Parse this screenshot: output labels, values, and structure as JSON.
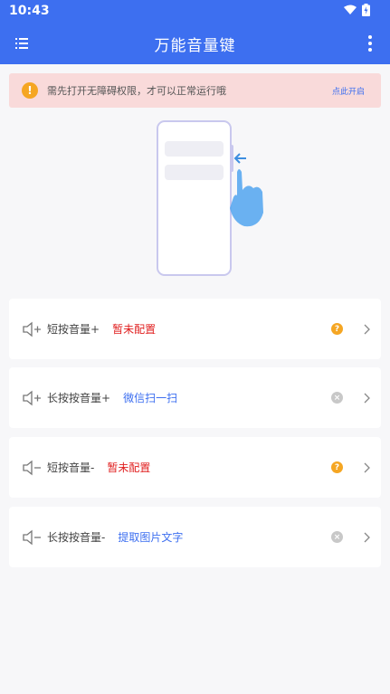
{
  "status_bar": {
    "time": "10:43"
  },
  "header": {
    "title": "万能音量键"
  },
  "banner": {
    "text": "需先打开无障碍权限，才可以正常运行哦",
    "link": "点此开启"
  },
  "cards": [
    {
      "label": "短按音量+",
      "value": "暂未配置",
      "value_color": "red",
      "status": "unconfigured",
      "icon": "volume-plus-icon"
    },
    {
      "label": "长按按音量+",
      "value": "微信扫一扫",
      "value_color": "blue",
      "status": "configured",
      "icon": "volume-plus-icon"
    },
    {
      "label": "短按音量-",
      "value": "暂未配置",
      "value_color": "red",
      "status": "unconfigured",
      "icon": "volume-minus-icon"
    },
    {
      "label": "长按按音量-",
      "value": "提取图片文字",
      "value_color": "blue",
      "status": "configured",
      "icon": "volume-minus-icon"
    }
  ],
  "colors": {
    "primary": "#3d6ff0",
    "warning": "#f5a623",
    "danger": "#e02020",
    "banner_bg": "#f9dada"
  }
}
